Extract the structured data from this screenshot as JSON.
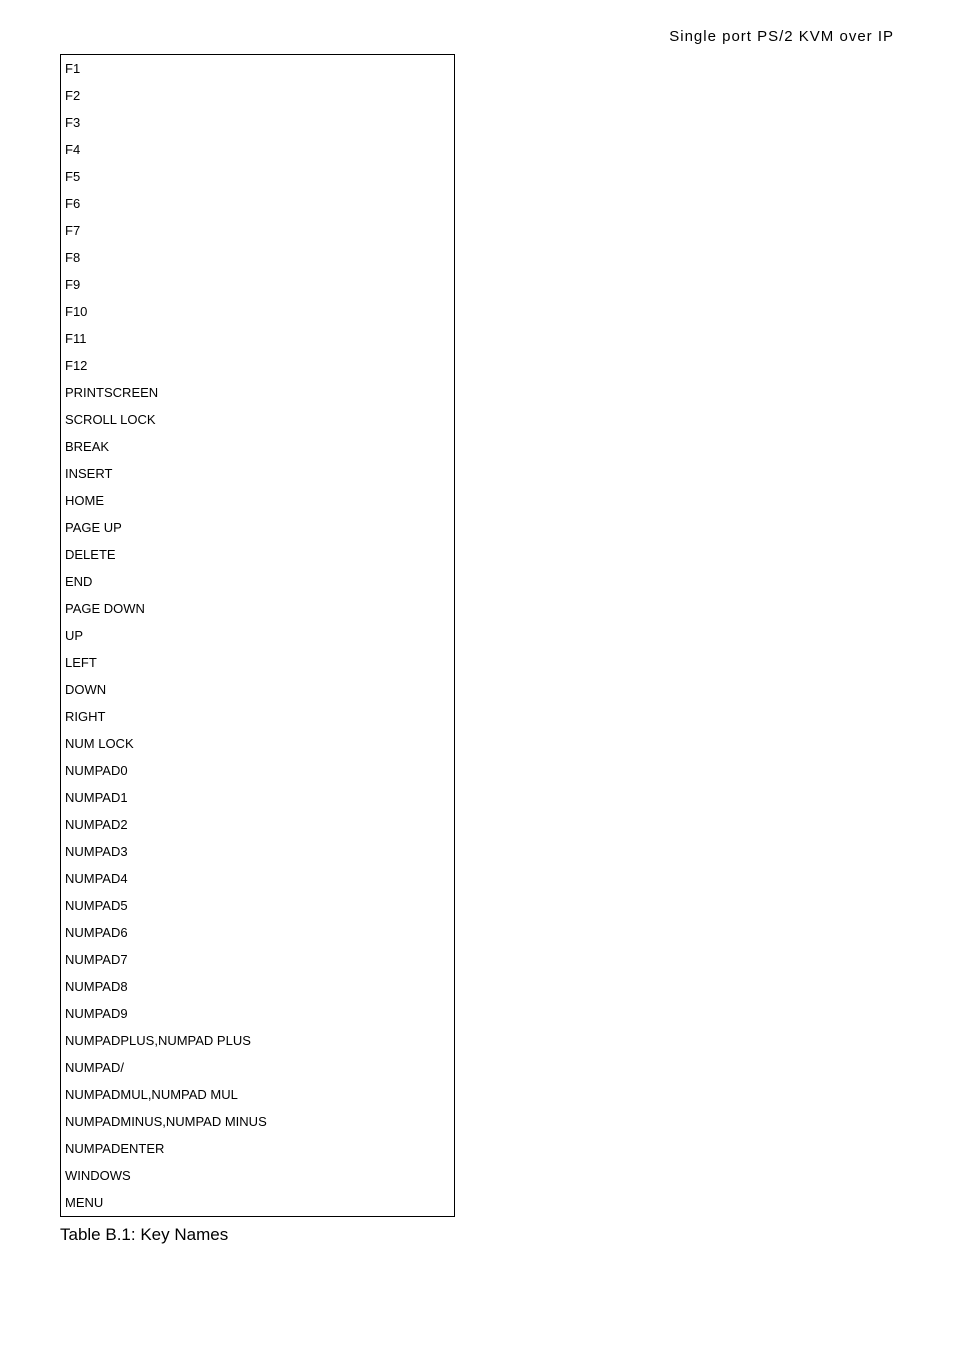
{
  "header": {
    "title": "Single port PS/2 KVM over IP"
  },
  "keys": [
    "F1",
    "F2",
    "F3",
    "F4",
    "F5",
    "F6",
    "F7",
    "F8",
    "F9",
    "F10",
    "F11",
    "F12",
    "PRINTSCREEN",
    "SCROLL LOCK",
    "BREAK",
    "INSERT",
    "HOME",
    "PAGE UP",
    "DELETE",
    "END",
    "PAGE DOWN",
    "UP",
    "LEFT",
    "DOWN",
    "RIGHT",
    "NUM LOCK",
    "NUMPAD0",
    "NUMPAD1",
    "NUMPAD2",
    "NUMPAD3",
    "NUMPAD4",
    "NUMPAD5",
    "NUMPAD6",
    "NUMPAD7",
    "NUMPAD8",
    "NUMPAD9",
    "NUMPADPLUS,NUMPAD PLUS",
    "NUMPAD/",
    "NUMPADMUL,NUMPAD MUL",
    "NUMPADMINUS,NUMPAD MINUS",
    "NUMPADENTER",
    "WINDOWS",
    "MENU"
  ],
  "caption": "Table B.1: Key Names"
}
